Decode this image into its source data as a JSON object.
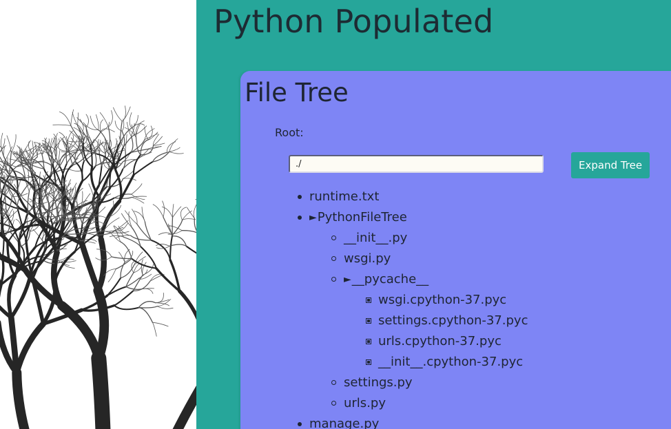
{
  "page": {
    "title": "Python Populated"
  },
  "panel": {
    "title": "File Tree",
    "root_label": "Root:",
    "root_input_value": "./",
    "expand_button": "Expand Tree"
  },
  "tree": {
    "expand_symbol": "►",
    "items": [
      {
        "label": "runtime.txt"
      },
      {
        "label": "PythonFileTree"
      },
      {
        "label": "__init__.py"
      },
      {
        "label": "wsgi.py"
      },
      {
        "label": "__pycache__"
      },
      {
        "label": "wsgi.cpython-37.pyc"
      },
      {
        "label": "settings.cpython-37.pyc"
      },
      {
        "label": "urls.cpython-37.pyc"
      },
      {
        "label": "__init__.cpython-37.pyc"
      },
      {
        "label": "settings.py"
      },
      {
        "label": "urls.py"
      },
      {
        "label": "manage.py"
      }
    ]
  },
  "colors": {
    "page_background": "#26a69a",
    "panel_background": "#7e85f5",
    "button_background": "#26a69a",
    "text": "#1e2533"
  }
}
